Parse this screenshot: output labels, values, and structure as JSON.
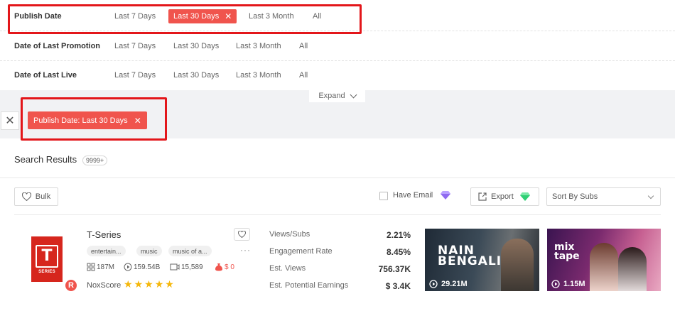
{
  "filters": {
    "rows": [
      {
        "label": "Publish Date",
        "options": [
          "Last 7 Days",
          "Last 30 Days",
          "Last 3 Month",
          "All"
        ],
        "active": "Last 30 Days"
      },
      {
        "label": "Date of Last Promotion",
        "options": [
          "Last 7 Days",
          "Last 30 Days",
          "Last 3 Month",
          "All"
        ]
      },
      {
        "label": "Date of Last Live",
        "options": [
          "Last 7 Days",
          "Last 30 Days",
          "Last 3 Month",
          "All"
        ]
      }
    ],
    "expand_label": "Expand",
    "selected_chip": "Publish Date: Last 30 Days"
  },
  "results": {
    "title": "Search Results",
    "count": "9999+",
    "toolbar": {
      "bulk_label": "Bulk",
      "have_email_label": "Have Email",
      "export_label": "Export",
      "sort_selected": "Sort By Subs"
    }
  },
  "channel": {
    "name": "T-Series",
    "avatar_letter": "T",
    "avatar_sub": "SERIES",
    "badge": "R",
    "tags": [
      "entertain...",
      "music",
      "music of a..."
    ],
    "more": "···",
    "stats": {
      "subs": "187M",
      "views": "159.54B",
      "videos": "15,589",
      "price": "$ 0"
    },
    "nox_label": "NoxScore",
    "nox_rating": 5,
    "star_glyph": "★",
    "metrics": [
      {
        "label": "Views/Subs",
        "value": "2.21%"
      },
      {
        "label": "Engagement Rate",
        "value": "8.45%"
      },
      {
        "label": "Est. Views",
        "value": "756.37K"
      },
      {
        "label": "Est. Potential Earnings",
        "value": "$ 3.4K"
      }
    ],
    "videos": [
      {
        "views": "29.21M",
        "title_text": "NAIN BENGALI"
      },
      {
        "views": "1.15M",
        "title_text": "mix tape"
      }
    ]
  },
  "colors": {
    "accent_red": "#f0544d",
    "highlight_box": "#e3161a",
    "star": "#f5b70a",
    "diamond_purple": "#8f6bf0",
    "diamond_green": "#2ecf73"
  }
}
